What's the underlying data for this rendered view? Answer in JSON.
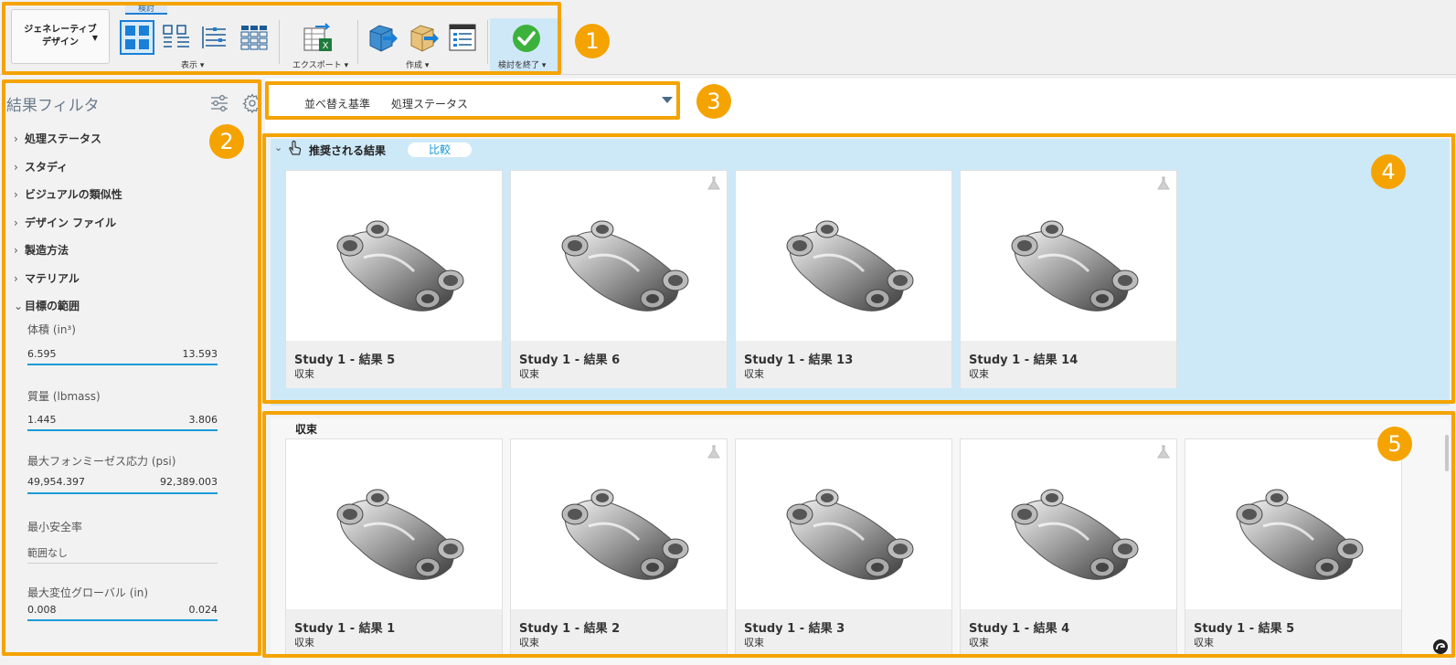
{
  "toolbar": {
    "workspace_label_line1": "ジェネレーティブ",
    "workspace_label_line2": "デザイン",
    "active_tab": "検討",
    "groups": [
      {
        "label": "表示"
      },
      {
        "label": "エクスポート"
      },
      {
        "label": "作成"
      },
      {
        "label": "検討を終了"
      }
    ]
  },
  "callouts": [
    "1",
    "2",
    "3",
    "4",
    "5"
  ],
  "filter": {
    "title": "結果フィルタ",
    "categories": [
      "処理ステータス",
      "スタディ",
      "ビジュアルの類似性",
      "デザイン ファイル",
      "製造方法",
      "マテリアル",
      "目標の範囲"
    ],
    "ranges": [
      {
        "label": "体積 (in³)",
        "min": "6.595",
        "max": "13.593"
      },
      {
        "label": "質量 (lbmass)",
        "min": "1.445",
        "max": "3.806"
      },
      {
        "label": "最大フォンミーゼス応力 (psi)",
        "min": "49,954.397",
        "max": "92,389.003"
      },
      {
        "label": "最小安全率",
        "min": "範囲なし",
        "max": ""
      },
      {
        "label": "最大変位グローバル (in)",
        "min": "0.008",
        "max": "0.024"
      }
    ]
  },
  "sort": {
    "label": "並べ替え基準",
    "value": "処理ステータス"
  },
  "recommended": {
    "title": "推奨される結果",
    "compare_label": "比較",
    "cards": [
      {
        "name": "Study 1 - 結果 5",
        "status": "収束",
        "flask": false
      },
      {
        "name": "Study 1 - 結果  6",
        "status": "収束",
        "flask": true
      },
      {
        "name": "Study 1 - 結果 13",
        "status": "収束",
        "flask": false
      },
      {
        "name": "Study 1 - 結果 14",
        "status": "収束",
        "flask": true
      }
    ]
  },
  "converged": {
    "title": "収束",
    "cards": [
      {
        "name": "Study 1 - 結果 1",
        "status": "収束",
        "flask": false
      },
      {
        "name": "Study 1 - 結果 2",
        "status": "収束",
        "flask": true
      },
      {
        "name": "Study 1 - 結果 3",
        "status": "収束",
        "flask": false
      },
      {
        "name": "Study 1 - 結果 4",
        "status": "収束",
        "flask": true
      },
      {
        "name": "Study 1 - 結果 5",
        "status": "収束",
        "flask": false
      }
    ]
  },
  "colors": {
    "callout": "#f4a300",
    "accent": "#1a9bd8",
    "recommended_bg": "#cde9f8"
  }
}
